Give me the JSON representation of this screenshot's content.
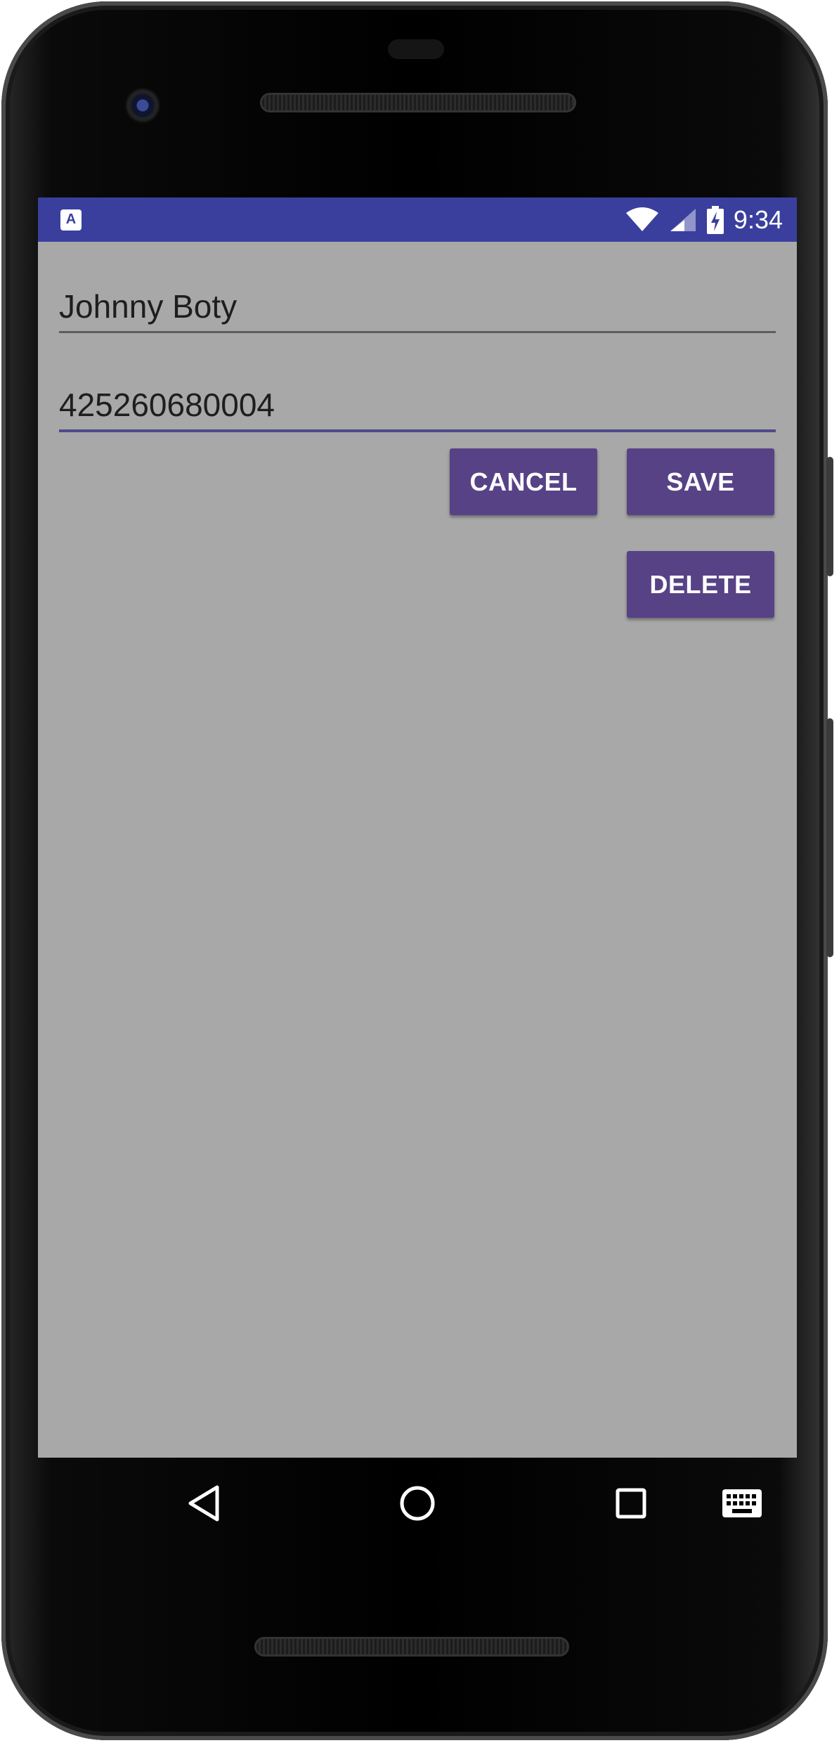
{
  "status_bar": {
    "time": "9:34",
    "notification_icon": "a-app-icon",
    "icons": [
      "wifi-icon",
      "signal-icon",
      "battery-charging-icon"
    ],
    "color": "#3a3f9e"
  },
  "form": {
    "name_value": "Johnny Boty",
    "phone_value": "425260680004"
  },
  "buttons": {
    "cancel_label": "CANCEL",
    "save_label": "SAVE",
    "delete_label": "DELETE",
    "color": "#574286"
  },
  "nav_bar": {
    "icons": [
      "back-icon",
      "home-icon",
      "recents-icon",
      "keyboard-icon"
    ]
  },
  "colors": {
    "background": "#a8a8a8",
    "accent": "#4f4a8e"
  }
}
